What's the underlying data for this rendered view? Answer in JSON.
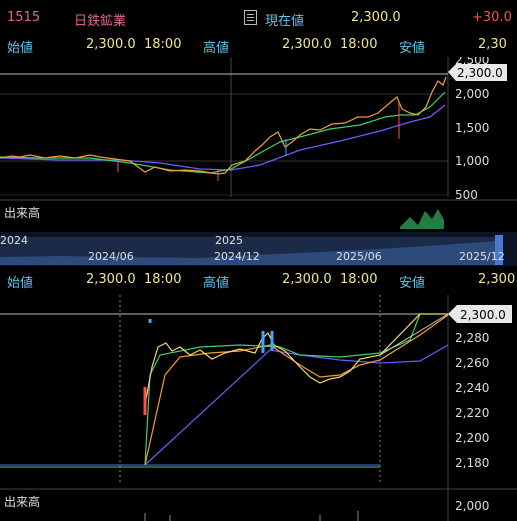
{
  "header": {
    "code": "1515",
    "name": "日鉄鉱業",
    "current_label": "現在値",
    "current_value": "2,300.0",
    "change": "+30.0"
  },
  "ohlc_row1": {
    "open_label": "始値",
    "open_value": "2,300.0",
    "open_time": "18:00",
    "high_label": "高値",
    "high_value": "2,300.0",
    "high_time": "18:00",
    "low_label": "安値",
    "low_value": "2,30"
  },
  "chart_top": {
    "price_tag": "2,300.0",
    "volume_label": "出来高",
    "y_ticks": [
      "2,500",
      "2,000",
      "1,500",
      "1,000",
      "500"
    ],
    "x_labels": [
      "2024",
      "2025"
    ],
    "navigator_labels": [
      "2024/06",
      "2024/12",
      "2025/06",
      "2025/12"
    ]
  },
  "ohlc_row2": {
    "open_label": "始値",
    "open_value": "2,300.0",
    "open_time": "18:00",
    "high_label": "高値",
    "high_value": "2,300.0",
    "high_time": "18:00",
    "low_label": "安値",
    "low_value": "2,300"
  },
  "chart_bottom": {
    "price_tag": "2,300.0",
    "volume_label": "出来高",
    "y_ticks": [
      "2,280",
      "2,260",
      "2,240",
      "2,220",
      "2,200",
      "2,180",
      "2,000"
    ]
  },
  "colors": {
    "label": "#5ec6e8",
    "value": "#f0e68c",
    "symbol": "#e2609a",
    "change": "#ff4d4d",
    "ma_short": "#f0a030",
    "ma_mid": "#3cd070",
    "ma_long": "#6a5cff"
  }
}
